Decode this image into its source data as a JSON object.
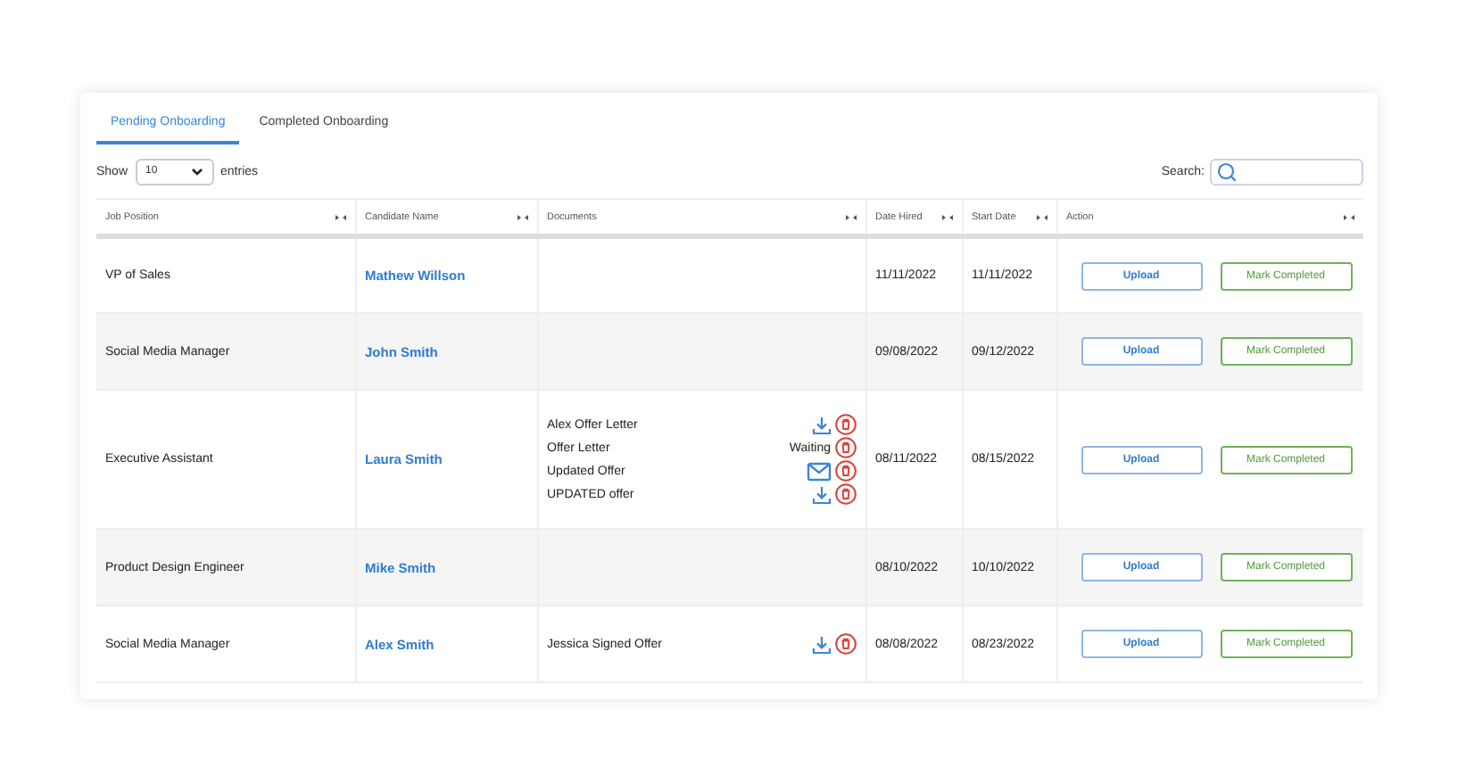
{
  "tabs": [
    {
      "label": "Pending Onboarding",
      "selected": true
    },
    {
      "label": "Completed Onboarding",
      "selected": false
    }
  ],
  "length_menu": {
    "before": "Show",
    "value": "10",
    "after": "entries"
  },
  "search": {
    "label": "Search:"
  },
  "table": {
    "columns": [
      "Job Position",
      "Candidate Name",
      "Documents",
      "Date Hired",
      "Start Date",
      "Action"
    ],
    "rows": [
      {
        "job": "VP of Sales",
        "candidate": "Mathew Willson",
        "documents": [],
        "date_hired": "11/11/2022",
        "start_date": "11/11/2022",
        "upload": "Upload",
        "complete": "Mark Completed"
      },
      {
        "job": "Social Media Manager",
        "candidate": "John Smith",
        "documents": [],
        "date_hired": "09/08/2022",
        "start_date": "09/12/2022",
        "upload": "Upload",
        "complete": "Mark Completed"
      },
      {
        "job": "Executive Assistant",
        "candidate": "Laura Smith",
        "documents": [
          {
            "name": "Alex Offer Letter",
            "kind": "download"
          },
          {
            "name": "Offer Letter",
            "kind": "status",
            "status": "Waiting"
          },
          {
            "name": "Updated Offer",
            "kind": "email"
          },
          {
            "name": "UPDATED offer",
            "kind": "download"
          }
        ],
        "date_hired": "08/11/2022",
        "start_date": "08/15/2022",
        "upload": "Upload",
        "complete": "Mark Completed"
      },
      {
        "job": "Product Design Engineer",
        "candidate": "Mike Smith",
        "documents": [],
        "date_hired": "08/10/2022",
        "start_date": "10/10/2022",
        "upload": "Upload",
        "complete": "Mark Completed"
      },
      {
        "job": "Social Media Manager",
        "candidate": "Alex Smith",
        "documents": [
          {
            "name": "Jessica Signed Offer",
            "kind": "download"
          }
        ],
        "date_hired": "08/08/2022",
        "start_date": "08/23/2022",
        "upload": "Upload",
        "complete": "Mark Completed"
      }
    ]
  }
}
